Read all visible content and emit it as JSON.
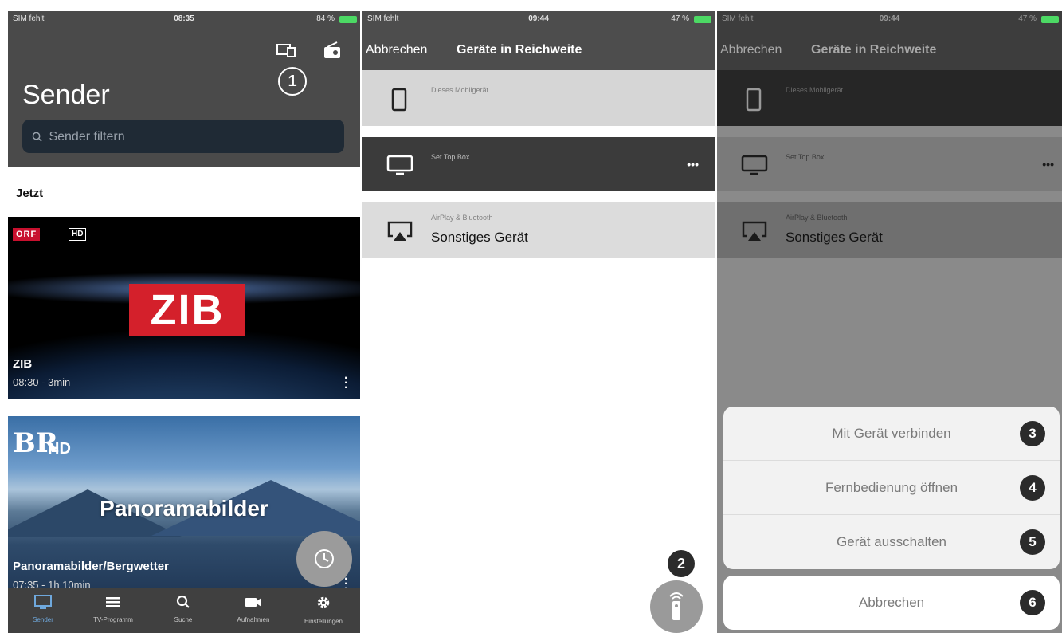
{
  "status_bars": [
    {
      "carrier": "SIM fehlt",
      "time": "08:35",
      "battery": "84 %"
    },
    {
      "carrier": "SIM fehlt",
      "time": "09:44",
      "battery": "47 %"
    },
    {
      "carrier": "SIM fehlt",
      "time": "09:44",
      "battery": "47 %"
    }
  ],
  "screen1": {
    "title": "Sender",
    "search_placeholder": "Sender filtern",
    "section": "Jetzt",
    "badge": "1",
    "cards": [
      {
        "channel_logo": "ORF",
        "hd": "HD",
        "show_logo": "ZIB",
        "title": "ZIB",
        "time": "08:30 - 3min"
      },
      {
        "channel_logo": "BR",
        "hd": "HD",
        "show_logo": "Panoramabilder",
        "title": "Panoramabilder/Bergwetter",
        "time": "07:35 - 1h 10min"
      }
    ],
    "tabs": [
      {
        "label": "Sender",
        "icon": "tv-icon",
        "active": true
      },
      {
        "label": "TV-Programm",
        "icon": "list-icon",
        "active": false
      },
      {
        "label": "Suche",
        "icon": "search-icon",
        "active": false
      },
      {
        "label": "Aufnahmen",
        "icon": "camera-icon",
        "active": false
      },
      {
        "label": "Einstellungen",
        "icon": "gear-icon",
        "active": false
      }
    ]
  },
  "screen2": {
    "cancel": "Abbrechen",
    "title": "Geräte in Reichweite",
    "devices": [
      {
        "subtitle": "Dieses Mobilgerät",
        "name": "",
        "icon": "phone-icon"
      },
      {
        "subtitle": "Set Top Box",
        "name": "",
        "icon": "tv-icon",
        "more": "•••"
      },
      {
        "subtitle": "AirPlay & Bluetooth",
        "name": "Sonstiges Gerät",
        "icon": "airplay-icon"
      }
    ],
    "badge": "2"
  },
  "screen3": {
    "cancel": "Abbrechen",
    "title": "Geräte in Reichweite",
    "devices": [
      {
        "subtitle": "Dieses Mobilgerät",
        "name": ""
      },
      {
        "subtitle": "Set Top Box",
        "name": "",
        "more": "•••"
      },
      {
        "subtitle": "AirPlay & Bluetooth",
        "name": "Sonstiges Gerät"
      }
    ],
    "actions": [
      {
        "label": "Mit Gerät verbinden",
        "badge": "3"
      },
      {
        "label": "Fernbedienung öffnen",
        "badge": "4"
      },
      {
        "label": "Gerät ausschalten",
        "badge": "5"
      }
    ],
    "cancel_action": {
      "label": "Abbrechen",
      "badge": "6"
    }
  }
}
